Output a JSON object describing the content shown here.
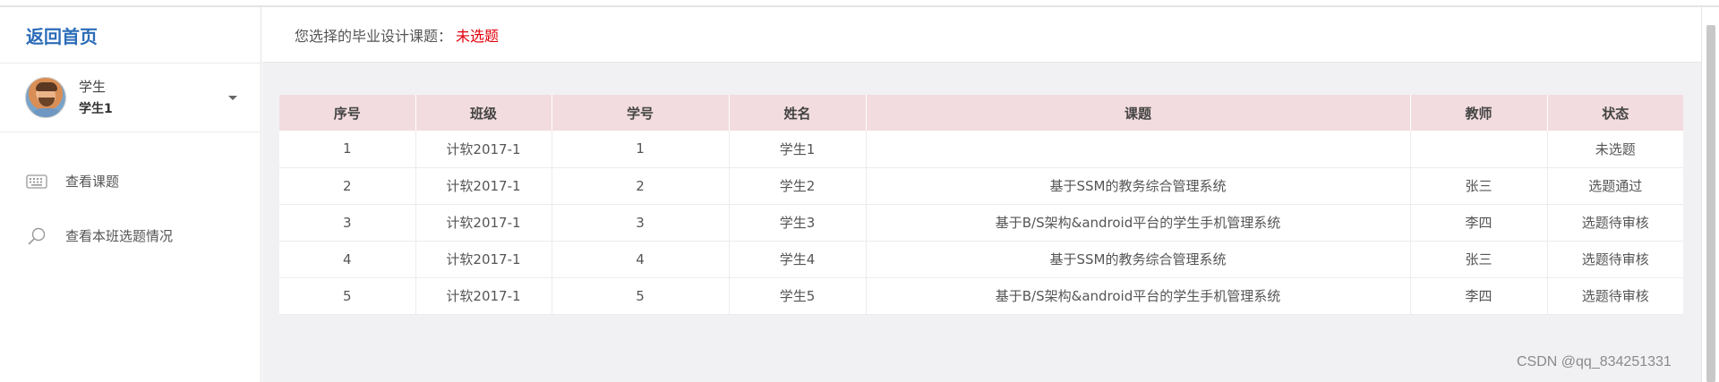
{
  "sidebar": {
    "brand": "返回首页",
    "user": {
      "role": "学生",
      "name": "学生1"
    },
    "menu": [
      {
        "label": "查看课题",
        "icon": "keyboard-icon"
      },
      {
        "label": "查看本班选题情况",
        "icon": "search-icon"
      }
    ]
  },
  "header": {
    "prefix": "您选择的毕业设计课题：",
    "status": "未选题",
    "status_color": "#e3000b"
  },
  "table": {
    "columns": [
      "序号",
      "班级",
      "学号",
      "姓名",
      "课题",
      "教师",
      "状态"
    ],
    "rows": [
      [
        "1",
        "计软2017-1",
        "1",
        "学生1",
        "",
        "",
        "未选题"
      ],
      [
        "2",
        "计软2017-1",
        "2",
        "学生2",
        "基于SSM的教务综合管理系统",
        "张三",
        "选题通过"
      ],
      [
        "3",
        "计软2017-1",
        "3",
        "学生3",
        "基于B/S架构&android平台的学生手机管理系统",
        "李四",
        "选题待审核"
      ],
      [
        "4",
        "计软2017-1",
        "4",
        "学生4",
        "基于SSM的教务综合管理系统",
        "张三",
        "选题待审核"
      ],
      [
        "5",
        "计软2017-1",
        "5",
        "学生5",
        "基于B/S架构&android平台的学生手机管理系统",
        "李四",
        "选题待审核"
      ]
    ]
  },
  "watermark": "CSDN @qq_834251331",
  "colors": {
    "brand": "#2b6cb8",
    "header_row": "#f2dcdf",
    "background": "#f1f1f4"
  }
}
